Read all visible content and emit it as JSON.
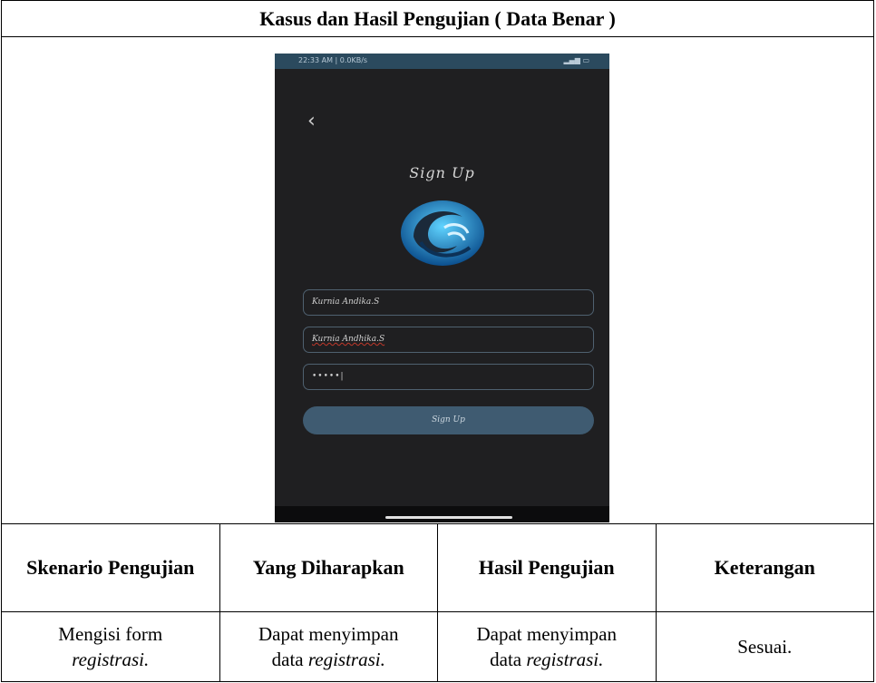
{
  "title": "Kasus dan Hasil Pengujian ( Data Benar )",
  "phone": {
    "status_time": "22:33 AM | 0.0KB/s",
    "status_right": "signal / battery",
    "back_icon": "chevron-left-icon",
    "screen_title": "Sign Up",
    "logo_icon": "water-wave-logo",
    "field_name": "Kurnia Andika.S",
    "field_username": "Kurnia Andhika.S",
    "field_password": "•••••|",
    "signup_button": "Sign Up"
  },
  "table": {
    "headers": [
      "Skenario Pengujian",
      "Yang Diharapkan",
      "Hasil Pengujian",
      "Keterangan"
    ],
    "row": {
      "col1_line1": "Mengisi form",
      "col1_line2": "registrasi.",
      "col2_line1": "Dapat menyimpan",
      "col2_pre": "data ",
      "col2_em": "registrasi.",
      "col3_line1": "Dapat menyimpan",
      "col3_pre": "data ",
      "col3_em": "registrasi.",
      "col4": "Sesuai."
    }
  }
}
